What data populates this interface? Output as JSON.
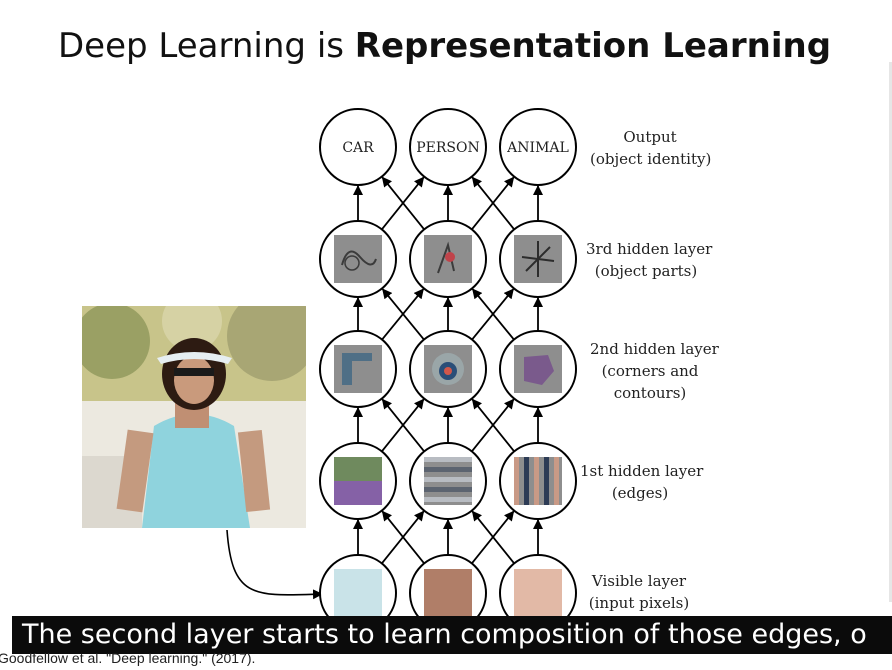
{
  "slide": {
    "title_plain": "Deep Learning is ",
    "title_bold": "Representation Learning",
    "citation": "Goodfellow et al. \"Deep learning.\" (2017).",
    "caption": "The second layer starts to learn composition of those edges, o"
  },
  "network": {
    "output_nodes": [
      "CAR",
      "PERSON",
      "ANIMAL"
    ],
    "layers": [
      {
        "id": "output",
        "line1": "Output",
        "line2": "(object identity)",
        "line3": ""
      },
      {
        "id": "hidden3",
        "line1": "3rd hidden layer",
        "line2": "(object parts)",
        "line3": ""
      },
      {
        "id": "hidden2",
        "line1": "2nd hidden layer",
        "line2": "(corners and",
        "line3": "contours)"
      },
      {
        "id": "hidden1",
        "line1": "1st hidden layer",
        "line2": "(edges)",
        "line3": ""
      },
      {
        "id": "visible",
        "line1": "Visible layer",
        "line2": "(input pixels)",
        "line3": ""
      }
    ],
    "pixel_colors": [
      "#c9e3e8",
      "#b07e68",
      "#e2b9a6"
    ]
  }
}
